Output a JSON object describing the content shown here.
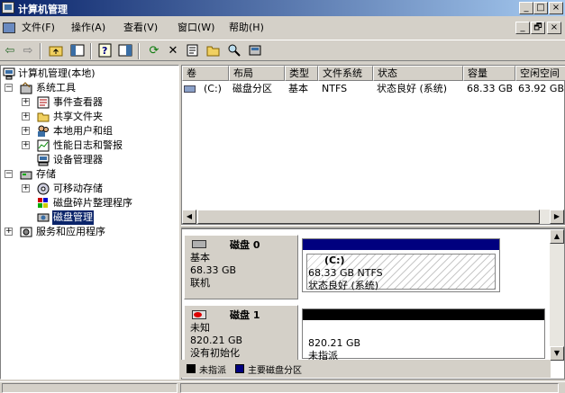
{
  "window": {
    "title": "计算机管理"
  },
  "menu": [
    "文件(F)",
    "操作(A)",
    "查看(V)",
    "窗口(W)",
    "帮助(H)"
  ],
  "tree": {
    "root": "计算机管理(本地)",
    "system_tools": "系统工具",
    "event_viewer": "事件查看器",
    "shared_folders": "共享文件夹",
    "local_users": "本地用户和组",
    "perf_logs": "性能日志和警报",
    "device_manager": "设备管理器",
    "storage": "存储",
    "removable": "可移动存储",
    "defrag": "磁盘碎片整理程序",
    "disk_mgmt": "磁盘管理",
    "services": "服务和应用程序"
  },
  "volume_list": {
    "columns": [
      "卷",
      "布局",
      "类型",
      "文件系统",
      "状态",
      "容量",
      "空闲空间"
    ],
    "rows": [
      [
        "(C:)",
        "磁盘分区",
        "基本",
        "NTFS",
        "状态良好 (系统)",
        "68.33 GB",
        "63.92 GB"
      ]
    ]
  },
  "disks": [
    {
      "name": "磁盘 0",
      "type": "基本",
      "size": "68.33 GB",
      "state": "联机",
      "partition": {
        "name": "(C:)",
        "detail": "68.33 GB NTFS",
        "status": "状态良好 (系统)",
        "bar_color": "#00007f"
      }
    },
    {
      "name": "磁盘 1",
      "type": "未知",
      "size": "820.21 GB",
      "state": "没有初始化",
      "partition": {
        "detail": "820.21 GB",
        "status": "未指派",
        "bar_color": "#000000"
      }
    }
  ],
  "legend": [
    {
      "label": "未指派",
      "color": "#000000"
    },
    {
      "label": "主要磁盘分区",
      "color": "#00007f"
    }
  ],
  "caption_buttons": [
    "_",
    "□",
    "×"
  ],
  "mdi_buttons": [
    "_",
    "🗗",
    "×"
  ]
}
